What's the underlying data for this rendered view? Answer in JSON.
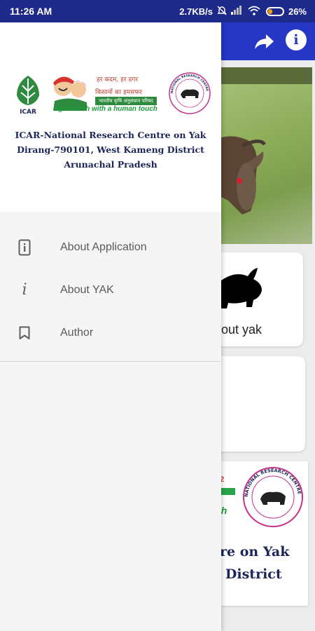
{
  "status_bar": {
    "time": "11:26 AM",
    "network_speed": "2.7KB/s",
    "battery_percent": "26%",
    "battery_level": 0.26,
    "icons": [
      "mute-icon",
      "signal-icon",
      "wifi-icon",
      "battery-icon"
    ]
  },
  "app_bar": {
    "color": "#2537c4",
    "icons": [
      "share-icon",
      "info-icon"
    ],
    "info_glyph": "i"
  },
  "background": {
    "about_yak_card_label": "out yak",
    "banner_line1": "re on Yak",
    "banner_line2": "g District",
    "banner_fragment_hindi": "2",
    "banner_fragment_en": "ch",
    "banner_badge_text": "NATIONAL RESEARCH CENTRE ON YAK"
  },
  "drawer": {
    "header": {
      "logo_hindi_tagline_1": "हर कदम, हर डगर",
      "logo_hindi_tagline_2": "किसानों का हमसफर",
      "logo_hindi_tagline_3": "भारतीय कृषि अनुसंधान परिषद",
      "logo_tagline": "Agrisearch with a human touch",
      "icar_label": "ICAR",
      "nrc_badge_text": "NATIONAL RESEARCH CENTRE ON YAK",
      "org_line1": "ICAR-National Research Centre on Yak",
      "org_line2": "Dirang-790101, West Kameng District",
      "org_line3": "Arunachal Pradesh"
    },
    "menu": [
      {
        "label": "About Application",
        "icon": "phone-info-icon"
      },
      {
        "label": "About YAK",
        "icon": "info-i-icon",
        "glyph": "i"
      },
      {
        "label": "Author",
        "icon": "bookmark-icon"
      }
    ]
  }
}
